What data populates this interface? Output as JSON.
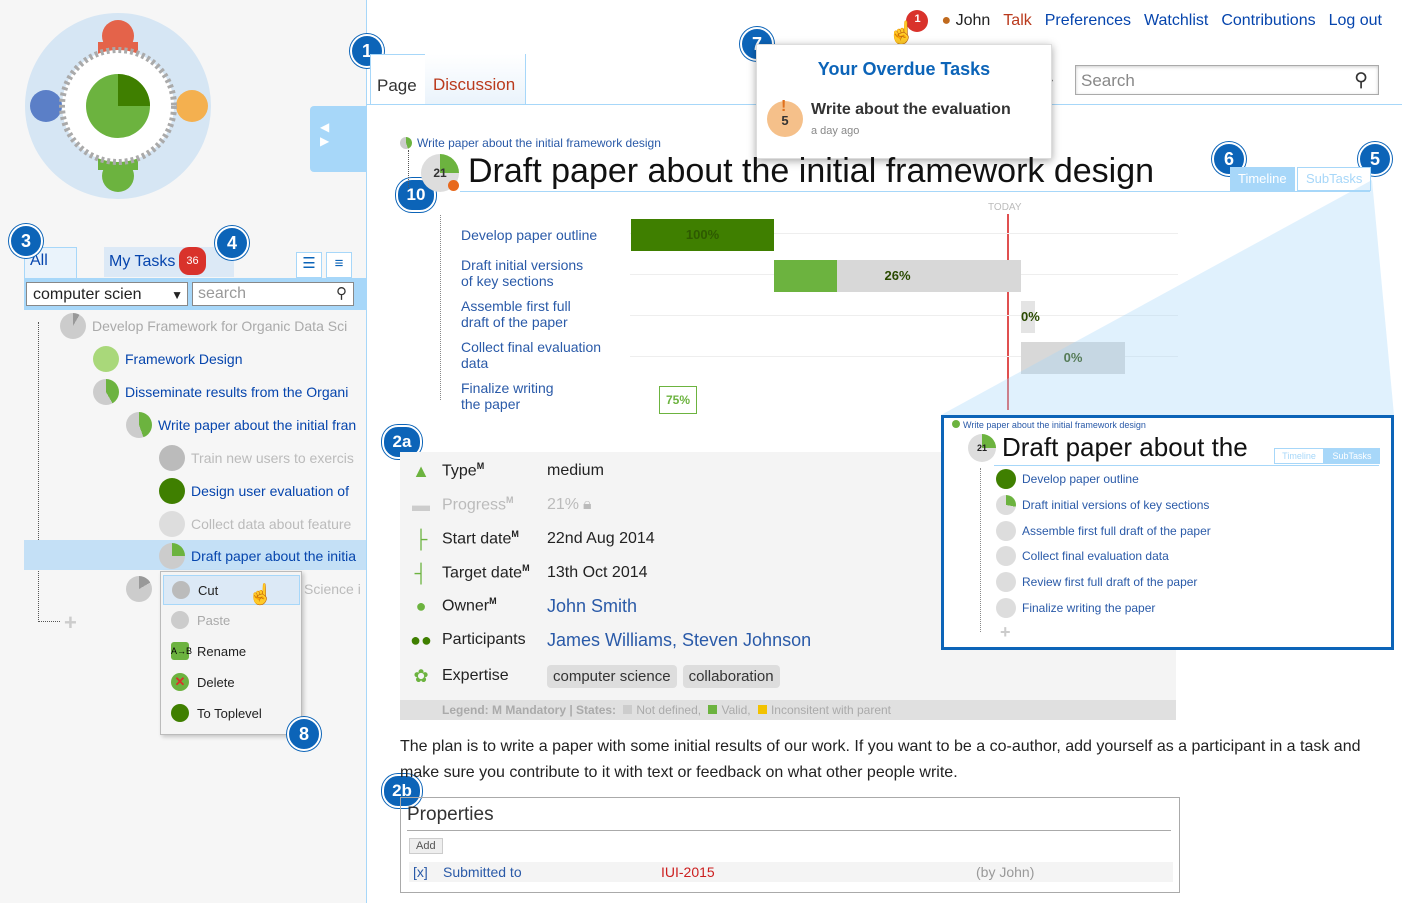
{
  "callouts": {
    "c1": "1",
    "c2a": "2a",
    "c2b": "2b",
    "c3": "3",
    "c4": "4",
    "c5": "5",
    "c6": "6",
    "c7": "7",
    "c8": "8",
    "c10": "10"
  },
  "usernav": {
    "notif_count": "1",
    "user": "John",
    "talk": "Talk",
    "preferences": "Preferences",
    "watchlist": "Watchlist",
    "contributions": "Contributions",
    "logout": "Log out"
  },
  "page_tabs": {
    "page": "Page",
    "discussion": "Discussion"
  },
  "search": {
    "placeholder": "Search"
  },
  "overdue": {
    "title": "Your Overdue Tasks",
    "task": "Write about the evaluation",
    "task_num": "5",
    "when": "a day ago"
  },
  "sidebar": {
    "tab_all": "All Tasks",
    "tab_my": "My Tasks",
    "my_count": "36",
    "filter_value": "computer scien",
    "search_placeholder": "search",
    "tree": [
      {
        "label": "Develop Framework for Organic Data Sci",
        "state": "undefined"
      },
      {
        "label": "Framework Design",
        "state": "valid"
      },
      {
        "label": "Disseminate results from the Organi",
        "state": "valid"
      },
      {
        "label": "Write paper about the initial fran",
        "state": "valid"
      },
      {
        "label": "Train new users to exercis",
        "state": "undefined"
      },
      {
        "label": "Design user evaluation of",
        "state": "valid"
      },
      {
        "label": "Collect data about feature",
        "state": "undefined"
      },
      {
        "label": "Draft paper about the initia",
        "state": "valid"
      },
      {
        "label": "Science i",
        "state": "undefined"
      }
    ]
  },
  "context_menu": {
    "cut": "Cut",
    "paste": "Paste",
    "rename": "Rename",
    "delete": "Delete",
    "toplevel": "To Toplevel"
  },
  "breadcrumb": "Write paper about the initial framework design",
  "title": "Draft paper about the initial framework design",
  "task_number": "21",
  "view_toggle": {
    "timeline": "Timeline",
    "subtasks": "SubTasks"
  },
  "today_label": "TODAY",
  "gantt": [
    {
      "label1": "Develop paper outline",
      "label2": "",
      "progress": "100%"
    },
    {
      "label1": "Draft initial versions",
      "label2": "of key sections",
      "progress": "26%"
    },
    {
      "label1": "Assemble first full",
      "label2": "draft of the paper",
      "progress": "0%"
    },
    {
      "label1": "Collect final evaluation",
      "label2": "data",
      "progress": "0%"
    },
    {
      "label1": "Finalize writing",
      "label2": "the paper",
      "progress": "75%"
    }
  ],
  "info": {
    "type_lbl": "Type",
    "type_val": "medium",
    "progress_lbl": "Progress",
    "progress_val": "21%",
    "start_lbl": "Start date",
    "start_val": "22nd Aug 2014",
    "target_lbl": "Target date",
    "target_val": "13th Oct 2014",
    "owner_lbl": "Owner",
    "owner_val": "John Smith",
    "participants_lbl": "Participants",
    "participants_val": "James Williams, Steven Johnson",
    "expertise_lbl": "Expertise",
    "expertise_1": "computer science",
    "expertise_2": "collaboration",
    "mandatory_mark": "M",
    "legend": "Legend: M Mandatory | States:",
    "legend_nd": "Not defined,",
    "legend_valid": "Valid,",
    "legend_inc": "Inconsitent with parent"
  },
  "description": "The plan is to write a paper with some initial results of our work. If you want to be a co-author, add yourself as a participant in a task and make sure you contribute to it with text or feedback on what other people write.",
  "properties": {
    "title": "Properties",
    "add": "Add",
    "remove": "[x]",
    "name": "Submitted to",
    "value": "IUI-2015",
    "by": "(by John)"
  },
  "zoom": {
    "breadcrumb": "Write paper about the initial framework design",
    "title": "Draft paper about the",
    "task_number": "21",
    "items": [
      "Develop paper outline",
      "Draft initial versions of key sections",
      "Assemble first full draft of the paper",
      "Collect final evaluation data",
      "Review first full draft of the paper",
      "Finalize writing the paper"
    ]
  },
  "colors": {
    "accent": "#0c64b8",
    "valid": "#6cb33f",
    "dark_green": "#3f7f00",
    "undefined": "#cccccc",
    "alert": "#d9322b"
  }
}
